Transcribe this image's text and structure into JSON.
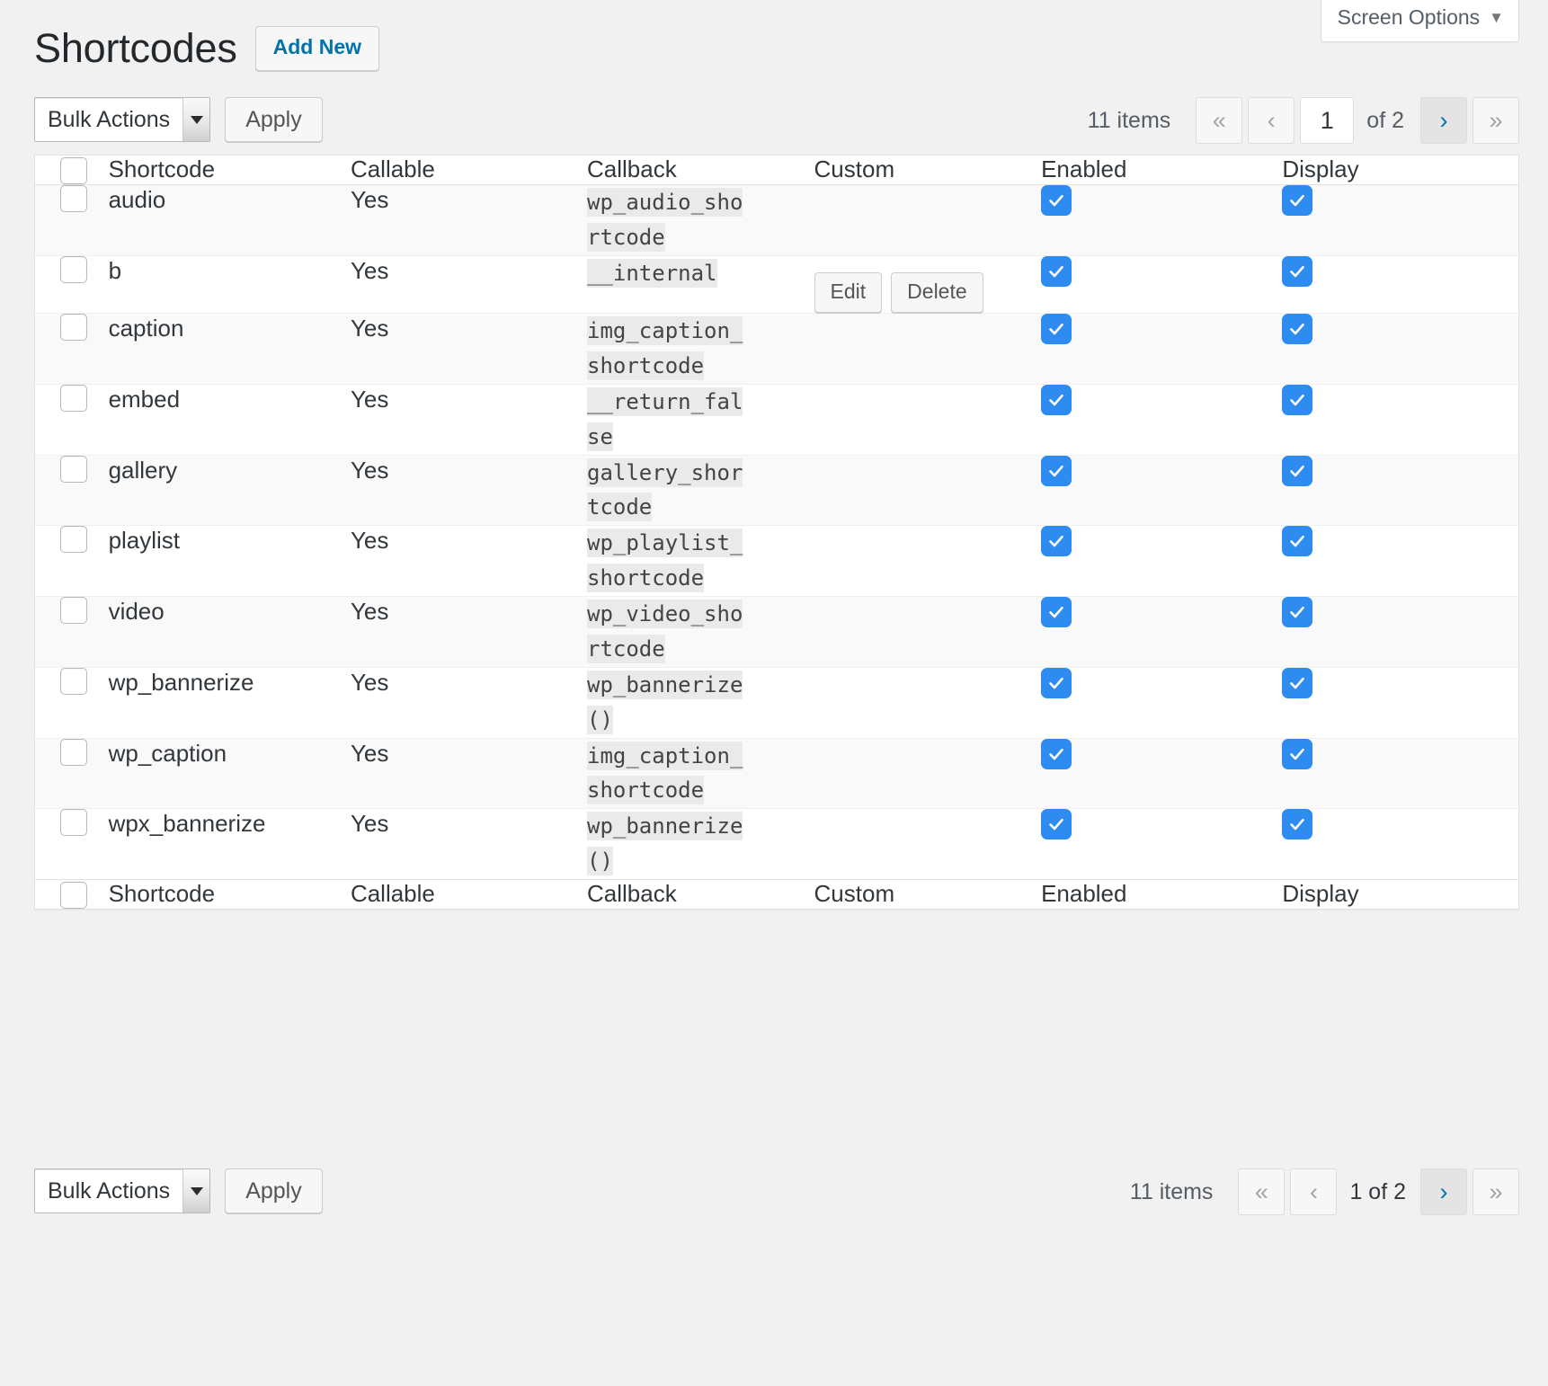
{
  "screen_options": {
    "label": "Screen Options",
    "caret": "chevron-down-icon"
  },
  "header": {
    "title": "Shortcodes",
    "add_new_label": "Add New"
  },
  "bulk": {
    "select_value": "Bulk Actions",
    "apply_label": "Apply"
  },
  "pagination_top": {
    "items_label": "11 items",
    "first_label": "«",
    "prev_label": "‹",
    "current_page": "1",
    "of_label": "of 2",
    "next_label": "›",
    "last_label": "»"
  },
  "pagination_bottom": {
    "items_label": "11 items",
    "first_label": "«",
    "prev_label": "‹",
    "paging_text": "1 of 2",
    "next_label": "›",
    "last_label": "»"
  },
  "table": {
    "columns": {
      "shortcode": "Shortcode",
      "callable": "Callable",
      "callback": "Callback",
      "custom": "Custom",
      "enabled": "Enabled",
      "display": "Display"
    },
    "row_actions": {
      "edit": "Edit",
      "delete": "Delete"
    },
    "rows": [
      {
        "shortcode": "audio",
        "callable": "Yes",
        "callback": "wp_audio_shortcode",
        "has_actions": false,
        "enabled": true,
        "display": true
      },
      {
        "shortcode": "b",
        "callable": "Yes",
        "callback": "__internal",
        "has_actions": true,
        "enabled": true,
        "display": true
      },
      {
        "shortcode": "caption",
        "callable": "Yes",
        "callback": "img_caption_shortcode",
        "has_actions": false,
        "enabled": true,
        "display": true
      },
      {
        "shortcode": "embed",
        "callable": "Yes",
        "callback": "__return_false",
        "has_actions": false,
        "enabled": true,
        "display": true
      },
      {
        "shortcode": "gallery",
        "callable": "Yes",
        "callback": "gallery_shortcode",
        "has_actions": false,
        "enabled": true,
        "display": true
      },
      {
        "shortcode": "playlist",
        "callable": "Yes",
        "callback": "wp_playlist_shortcode",
        "has_actions": false,
        "enabled": true,
        "display": true
      },
      {
        "shortcode": "video",
        "callable": "Yes",
        "callback": "wp_video_shortcode",
        "has_actions": false,
        "enabled": true,
        "display": true
      },
      {
        "shortcode": "wp_bannerize",
        "callable": "Yes",
        "callback": "wp_bannerize()",
        "has_actions": false,
        "enabled": true,
        "display": true
      },
      {
        "shortcode": "wp_caption",
        "callable": "Yes",
        "callback": "img_caption_shortcode",
        "has_actions": false,
        "enabled": true,
        "display": true
      },
      {
        "shortcode": "wpx_bannerize",
        "callable": "Yes",
        "callback": "wp_bannerize()",
        "has_actions": false,
        "enabled": true,
        "display": true
      }
    ]
  },
  "colors": {
    "accent_link": "#0073aa",
    "checkbox_on": "#2e8bf0",
    "page_bg": "#f1f1f1",
    "row_alt_bg": "#f9f9f9",
    "code_bg": "#eaeaea"
  }
}
